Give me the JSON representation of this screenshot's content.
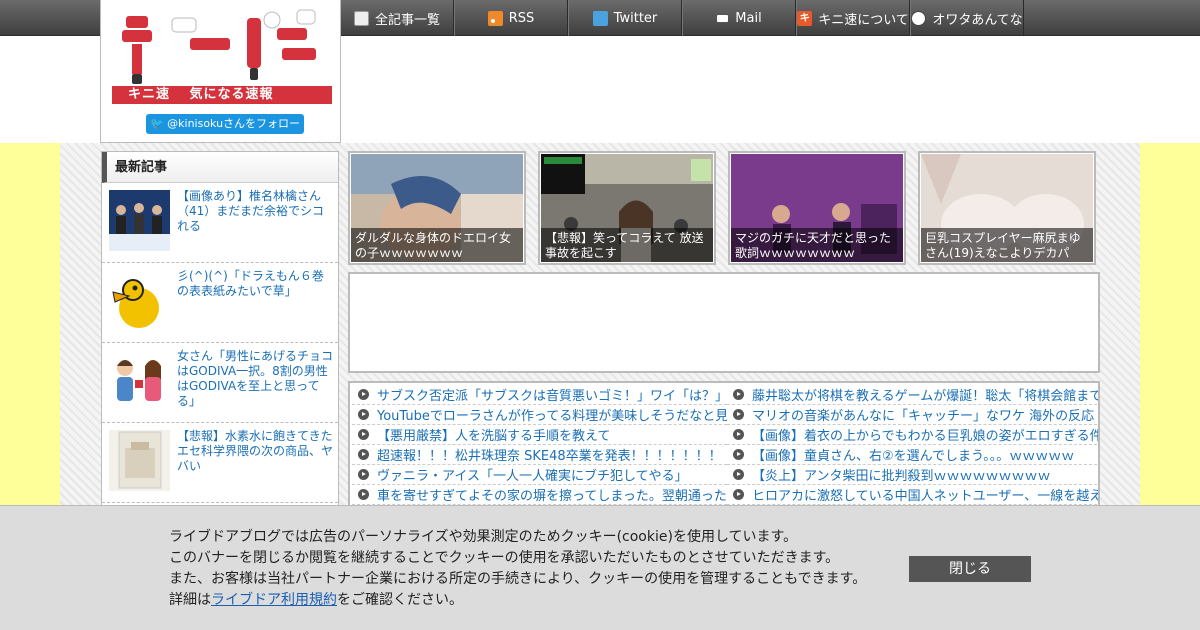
{
  "nav": {
    "items": [
      {
        "label": "全記事一覧",
        "icon": "list-icon"
      },
      {
        "label": "RSS",
        "icon": "rss-icon"
      },
      {
        "label": "Twitter",
        "icon": "twitter-icon"
      },
      {
        "label": "Mail",
        "icon": "mail-icon"
      },
      {
        "label": "キニ速について",
        "icon": "kini-icon"
      },
      {
        "label": "オワタあんてな",
        "icon": "owata-icon"
      }
    ]
  },
  "logo": {
    "band_text": "キニ速　 気になる速報",
    "brand_color": "#d4323c",
    "follow_label": "@kinisokuさんをフォロー"
  },
  "sidebar": {
    "heading": "最新記事",
    "items": [
      {
        "title": "【画像あり】椎名林檎さん（41）まだまだ余裕でシコれる"
      },
      {
        "title": "彡(^)(^)「ドラえもん６巻の表表紙みたいで草」"
      },
      {
        "title": "女さん「男性にあげるチョコはGODIVA一択。8割の男性はGODIVAを至上と思ってる」"
      },
      {
        "title": "【悲報】水素水に飽きてきたエセ科学界隈の次の商品、ヤバい"
      }
    ]
  },
  "featured": [
    {
      "caption": "ダルダルな身体のドエロイ女の子ｗｗｗｗｗｗｗ"
    },
    {
      "caption": "【悲報】笑ってコラえて 放送事故を起こす"
    },
    {
      "caption": "マジのガチに天才だと思った歌詞ｗｗｗｗｗｗｗｗ"
    },
    {
      "caption": "巨乳コスプレイヤー麻尻まゆさん(19)えなこよりデカパ"
    }
  ],
  "headlines": {
    "left": [
      "サブスク否定派「サブスクは音質悪いゴミ！」ワイ「は？」",
      "YouTubeでローラさんが作ってる料理が美味しそうだなと見",
      "【悪用厳禁】人を洗脳する手順を教えて",
      "超速報！！！松井珠理奈 SKE48卒業を発表！！！！！！！",
      "ヴァニラ・アイス「一人一人確実にブチ犯してやる」",
      "車を寄せすぎてよその家の塀を擦ってしまった。翌朝通った"
    ],
    "right": [
      "藤井聡太が将棋を教えるゲームが爆誕！聡太「将棋会館まで",
      "マリオの音楽があんなに「キャッチー」なワケ 海外の反応",
      "【画像】着衣の上からでもわかる巨乳娘の姿がエロすぎる件",
      "【画像】童貞さん、右②を選んでしまう。。。ｗｗｗｗｗ",
      "【炎上】アンタ柴田に批判殺到ｗｗｗｗｗｗｗｗｗ",
      "ヒロアカに激怒している中国人ネットユーザー、一線を越え"
    ]
  },
  "cookie": {
    "line1": "ライブドアブログでは広告のパーソナライズや効果測定のためクッキー(cookie)を使用しています。",
    "line2": "このバナーを閉じるか閲覧を継続することでクッキーの使用を承認いただいたものとさせていただきます。",
    "line3": "また、お客様は当社パートナー企業における所定の手続きにより、クッキーの使用を管理することもできます。",
    "line4_prefix": "詳細は",
    "line4_link": "ライブドア利用規約",
    "line4_suffix": "をご確認ください。",
    "close_label": "閉じる"
  }
}
